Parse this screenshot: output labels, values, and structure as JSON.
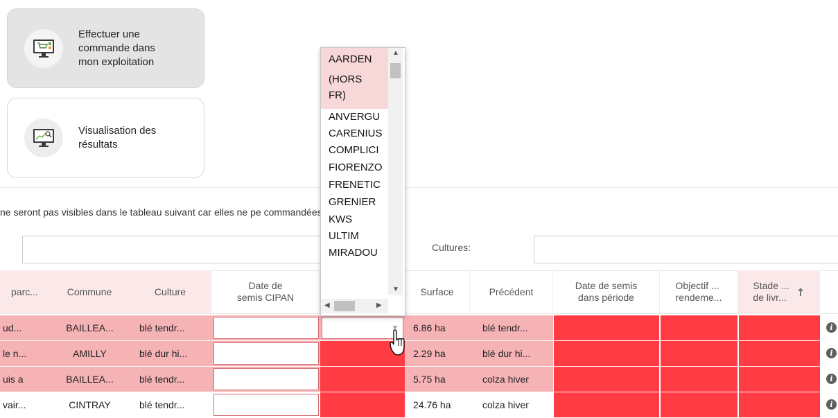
{
  "actions": {
    "order": {
      "label": "Effectuer une\ncommande dans\nmon exploitation",
      "icon": "cart-monitor-icon"
    },
    "results": {
      "label": "Visualisation des\nrésultats",
      "icon": "chart-monitor-icon"
    }
  },
  "notice": "ne seront pas visibles dans le tableau suivant car elles ne pe                      commandées.",
  "filters": {
    "cultures_label": "Cultures:",
    "search_value": "",
    "cultures_value": ""
  },
  "table": {
    "headers": {
      "parcelle": "parc...",
      "commune": "Commune",
      "culture": "Culture",
      "date_cipan": "Date de\nsemis CIPAN",
      "variete": "",
      "surface": "Surface",
      "precedent": "Précédent",
      "date_periode": "Date de semis\ndans période",
      "objectif": "Objectif ...\nrendeme...",
      "stade": "Stade ...\nde livr..."
    },
    "rows": [
      {
        "parcelle": "ud...",
        "commune": "BAILLEA...",
        "culture": "blé tendr...",
        "surface": "6.86 ha",
        "precedent": "blé tendr..."
      },
      {
        "parcelle": "le n...",
        "commune": "AMILLY",
        "culture": "blé dur hi...",
        "surface": "2.29 ha",
        "precedent": "blé dur hi..."
      },
      {
        "parcelle": "uis a",
        "commune": "BAILLEA...",
        "culture": "blé tendr...",
        "surface": "5.75 ha",
        "precedent": "colza hiver"
      },
      {
        "parcelle": "vair...",
        "commune": "CINTRAY",
        "culture": "blé tendr...",
        "surface": "24.76 ha",
        "precedent": "colza hiver"
      }
    ]
  },
  "dropdown": {
    "options": [
      "AARDEN",
      "(HORS",
      "FR)",
      "ANVERGU",
      "CARENIUS",
      "COMPLICI",
      "FIORENZO",
      "FRENETIC",
      "GRENIER",
      "KWS",
      "ULTIM",
      "MIRADOU"
    ],
    "selected": "AARDEN (HORS FR)"
  },
  "colors": {
    "pink_row": "#f6b3b6",
    "red_cell": "#ff3c44",
    "header_pink": "#fbe9ea",
    "selected_option": "#f8d7d9"
  }
}
